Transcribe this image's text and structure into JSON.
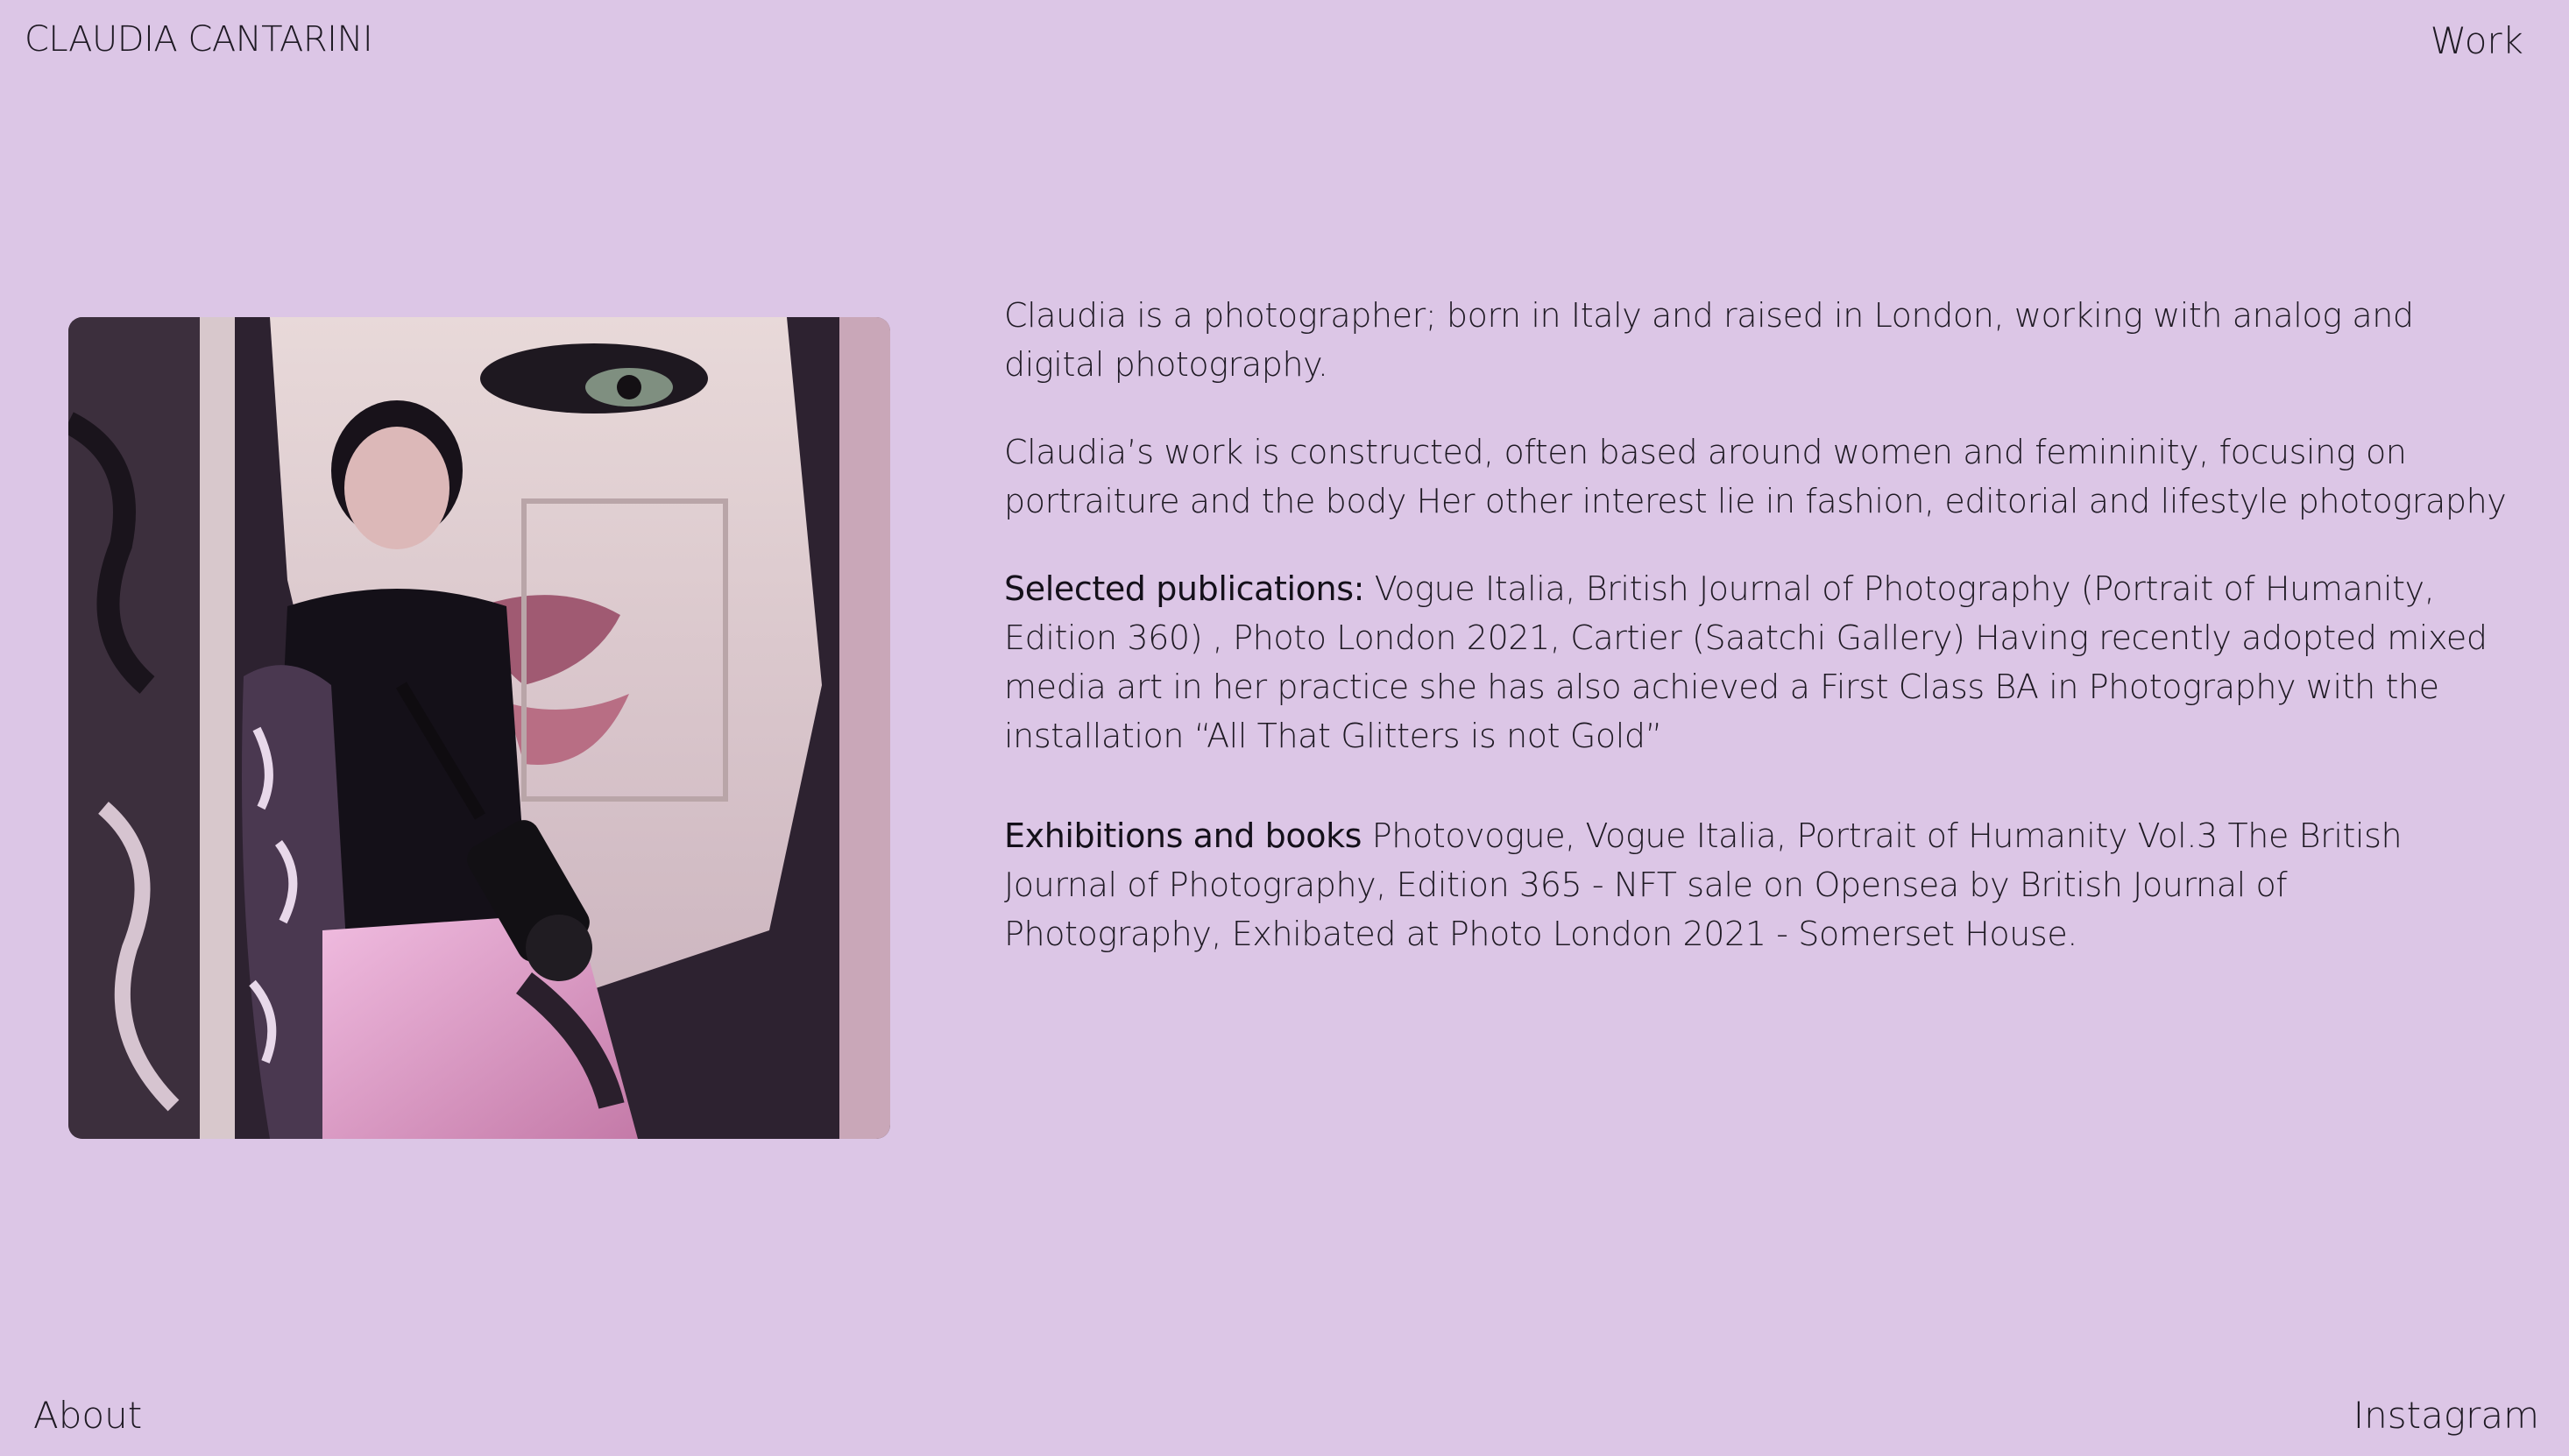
{
  "header": {
    "site_title": "CLAUDIA CANTARINI",
    "work_label": "Work"
  },
  "footer": {
    "about_label": "About",
    "instagram_label": "Instagram"
  },
  "bio": {
    "intro": "Claudia is a photographer; born in Italy and raised in London, working with analog and digital photography.",
    "work": "Claudia’s work is constructed, often based around women and femininity, focusing on portraiture and the body Her other interest lie in fashion, editorial and lifestyle photography",
    "publications_label": "Selected publications:",
    "publications_text": " Vogue Italia, British Journal of Photography (Portrait of Humanity, Edition 360) , Photo London 2021, Cartier (Saatchi Gallery) Having recently adopted mixed media art in her practice she has also achieved a First Class BA in Photography with the installation “All That Glitters is not Gold”",
    "exhibitions_label": "Exhibitions and books",
    "exhibitions_text": " Photovogue, Vogue Italia, Portrait of Humanity Vol.3 The British Journal of Photography, Edition 365 - NFT sale on Opensea by British Journal of Photography, Exhibated at Photo London 2021 - Somerset House."
  },
  "colors": {
    "background": "#dcc6e6",
    "text": "#1f1a24"
  }
}
